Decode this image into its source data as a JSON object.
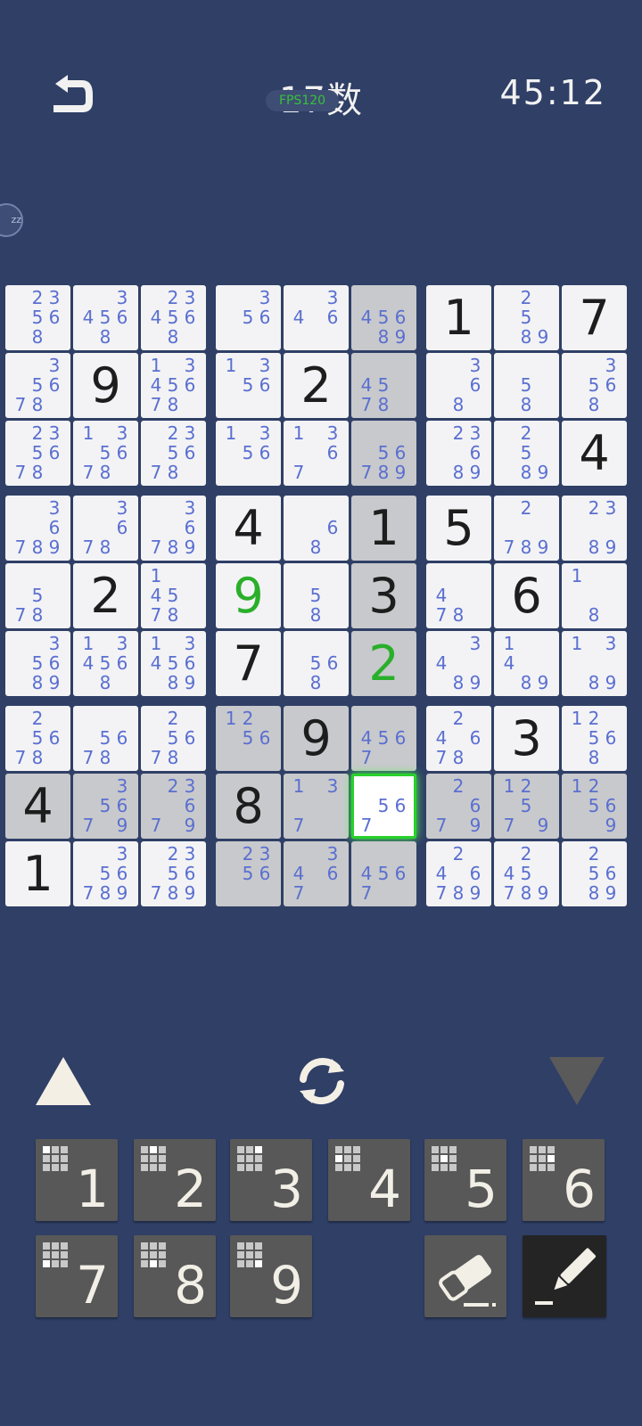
{
  "header": {
    "title": "17数",
    "fps": "FPS120",
    "timer": "45:12",
    "zz_label": "zz"
  },
  "colors": {
    "background": "#2f3f66",
    "pencil_mark": "#5a6fd0",
    "given_digit": "#1d1d1d",
    "entered_digit": "#2aaf2a",
    "selection_glow": "#28d12a"
  },
  "board": {
    "rows": [
      [
        {
          "pm": [
            2,
            3,
            5,
            6,
            8
          ]
        },
        {
          "pm": [
            3,
            4,
            5,
            6,
            8
          ]
        },
        {
          "pm": [
            2,
            3,
            4,
            5,
            6,
            8
          ]
        },
        {
          "pm": [
            3,
            5,
            6
          ]
        },
        {
          "pm": [
            3,
            4,
            6
          ]
        },
        {
          "pm": [
            4,
            5,
            6,
            8,
            9
          ],
          "shade": true
        },
        {
          "v": "1"
        },
        {
          "pm": [
            2,
            5,
            8,
            9
          ]
        },
        {
          "v": "7"
        }
      ],
      [
        {
          "pm": [
            3,
            5,
            6,
            7,
            8
          ]
        },
        {
          "v": "9"
        },
        {
          "pm": [
            1,
            3,
            4,
            5,
            6,
            7,
            8
          ]
        },
        {
          "pm": [
            1,
            3,
            5,
            6
          ]
        },
        {
          "v": "2"
        },
        {
          "pm": [
            4,
            5,
            7,
            8
          ],
          "shade": true
        },
        {
          "pm": [
            3,
            6,
            8
          ]
        },
        {
          "pm": [
            5,
            8
          ]
        },
        {
          "pm": [
            3,
            5,
            6,
            8
          ]
        }
      ],
      [
        {
          "pm": [
            2,
            3,
            5,
            6,
            7,
            8
          ]
        },
        {
          "pm": [
            1,
            3,
            5,
            6,
            7,
            8
          ]
        },
        {
          "pm": [
            2,
            3,
            5,
            6,
            7,
            8
          ]
        },
        {
          "pm": [
            1,
            3,
            5,
            6
          ]
        },
        {
          "pm": [
            1,
            3,
            6,
            7
          ]
        },
        {
          "pm": [
            5,
            6,
            7,
            8,
            9
          ],
          "shade": true
        },
        {
          "pm": [
            2,
            3,
            6,
            8,
            9
          ]
        },
        {
          "pm": [
            2,
            5,
            8,
            9
          ]
        },
        {
          "v": "4"
        }
      ],
      [
        {
          "pm": [
            3,
            6,
            7,
            8,
            9
          ]
        },
        {
          "pm": [
            3,
            6,
            7,
            8
          ]
        },
        {
          "pm": [
            3,
            6,
            7,
            8,
            9
          ]
        },
        {
          "v": "4"
        },
        {
          "pm": [
            6,
            8
          ]
        },
        {
          "v": "1",
          "shade": true
        },
        {
          "v": "5"
        },
        {
          "pm": [
            2,
            7,
            8,
            9
          ]
        },
        {
          "pm": [
            2,
            3,
            8,
            9
          ]
        }
      ],
      [
        {
          "pm": [
            5,
            7,
            8
          ]
        },
        {
          "v": "2"
        },
        {
          "pm": [
            1,
            4,
            5,
            7,
            8
          ]
        },
        {
          "v": "9",
          "green": true
        },
        {
          "pm": [
            5,
            8
          ]
        },
        {
          "v": "3",
          "shade": true
        },
        {
          "pm": [
            4,
            7,
            8
          ]
        },
        {
          "v": "6"
        },
        {
          "pm": [
            1,
            8
          ]
        }
      ],
      [
        {
          "pm": [
            3,
            5,
            6,
            8,
            9
          ]
        },
        {
          "pm": [
            1,
            3,
            4,
            5,
            6,
            8
          ]
        },
        {
          "pm": [
            1,
            3,
            4,
            5,
            6,
            8,
            9
          ]
        },
        {
          "v": "7"
        },
        {
          "pm": [
            5,
            6,
            8
          ]
        },
        {
          "v": "2",
          "green": true,
          "shade": true
        },
        {
          "pm": [
            3,
            4,
            8,
            9
          ]
        },
        {
          "pm": [
            1,
            4,
            8,
            9
          ]
        },
        {
          "pm": [
            1,
            3,
            8,
            9
          ]
        }
      ],
      [
        {
          "pm": [
            2,
            5,
            6,
            7,
            8
          ]
        },
        {
          "pm": [
            5,
            6,
            7,
            8
          ]
        },
        {
          "pm": [
            2,
            5,
            6,
            7,
            8
          ]
        },
        {
          "pm": [
            1,
            2,
            5,
            6
          ],
          "shade": true
        },
        {
          "v": "9",
          "shade": true
        },
        {
          "pm": [
            4,
            5,
            6,
            7
          ],
          "shade": true
        },
        {
          "pm": [
            2,
            4,
            6,
            7,
            8
          ]
        },
        {
          "v": "3"
        },
        {
          "pm": [
            1,
            2,
            5,
            6,
            8
          ]
        }
      ],
      [
        {
          "v": "4",
          "shade": true
        },
        {
          "pm": [
            3,
            5,
            6,
            7,
            9
          ],
          "shade": true
        },
        {
          "pm": [
            2,
            3,
            6,
            7,
            9
          ],
          "shade": true
        },
        {
          "v": "8",
          "shade": true
        },
        {
          "pm": [
            1,
            3,
            7
          ],
          "shade": true
        },
        {
          "pm": [
            5,
            6,
            7
          ],
          "sel": true
        },
        {
          "pm": [
            2,
            6,
            7,
            9
          ],
          "shade": true
        },
        {
          "pm": [
            1,
            2,
            5,
            7,
            9
          ],
          "shade": true
        },
        {
          "pm": [
            1,
            2,
            5,
            6,
            9
          ],
          "shade": true
        }
      ],
      [
        {
          "v": "1"
        },
        {
          "pm": [
            3,
            5,
            6,
            7,
            8,
            9
          ]
        },
        {
          "pm": [
            2,
            3,
            5,
            6,
            7,
            8,
            9
          ]
        },
        {
          "pm": [
            2,
            3,
            5,
            6
          ],
          "shade": true
        },
        {
          "pm": [
            3,
            4,
            6,
            7
          ],
          "shade": true
        },
        {
          "pm": [
            4,
            5,
            6,
            7
          ],
          "shade": true
        },
        {
          "pm": [
            2,
            4,
            6,
            7,
            8,
            9
          ]
        },
        {
          "pm": [
            2,
            4,
            5,
            7,
            8,
            9
          ]
        },
        {
          "pm": [
            2,
            5,
            6,
            8,
            9
          ]
        }
      ]
    ]
  },
  "controls": {
    "up_icon": "triangle-up-icon",
    "refresh_icon": "refresh-icon",
    "down_icon": "triangle-down-icon",
    "numbers": [
      {
        "label": "1",
        "hint": [
          1,
          0,
          0,
          0,
          0,
          0,
          0,
          0,
          0
        ]
      },
      {
        "label": "2",
        "hint": [
          0,
          1,
          0,
          0,
          0,
          0,
          0,
          0,
          0
        ]
      },
      {
        "label": "3",
        "hint": [
          0,
          0,
          1,
          0,
          0,
          0,
          0,
          0,
          0
        ]
      },
      {
        "label": "4",
        "hint": [
          0,
          0,
          0,
          1,
          0,
          0,
          0,
          0,
          0
        ]
      },
      {
        "label": "5",
        "hint": [
          0,
          0,
          0,
          0,
          1,
          0,
          0,
          0,
          0
        ]
      },
      {
        "label": "6",
        "hint": [
          0,
          0,
          0,
          0,
          0,
          1,
          0,
          0,
          0
        ]
      },
      {
        "label": "7",
        "hint": [
          0,
          0,
          0,
          0,
          0,
          0,
          1,
          0,
          0
        ]
      },
      {
        "label": "8",
        "hint": [
          0,
          0,
          0,
          0,
          0,
          0,
          0,
          1,
          0
        ]
      },
      {
        "label": "9",
        "hint": [
          0,
          0,
          0,
          0,
          0,
          0,
          0,
          0,
          1
        ]
      }
    ],
    "eraser_icon": "eraser-icon",
    "pencil_icon": "pencil-icon"
  }
}
